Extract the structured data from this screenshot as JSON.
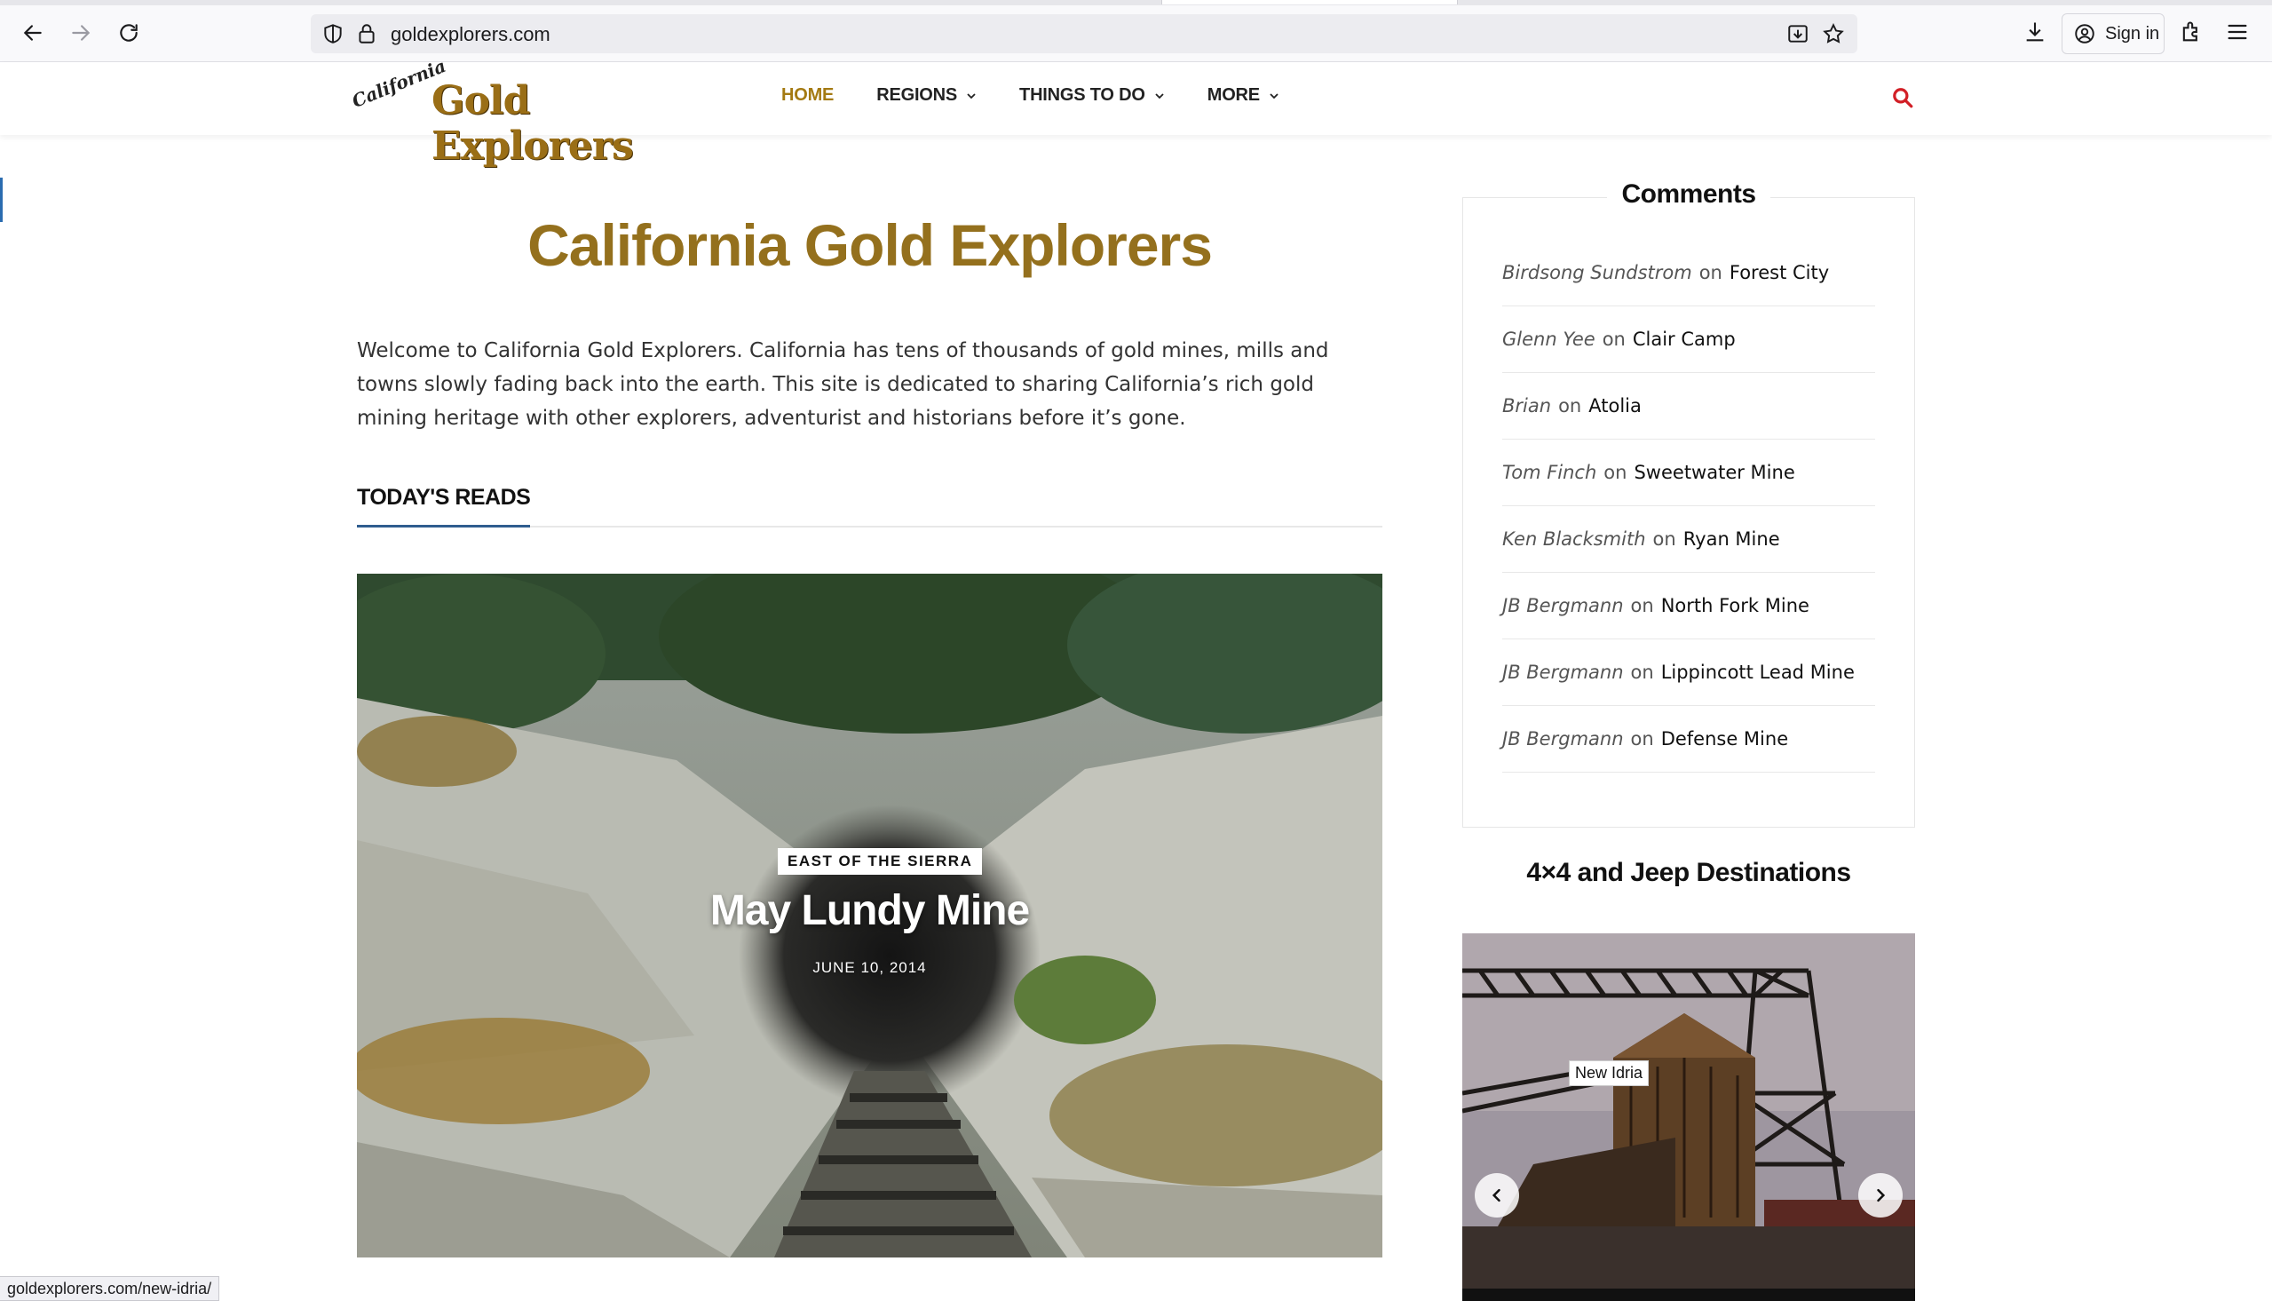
{
  "browser": {
    "url": "goldexplorers.com",
    "sign_in_label": "Sign in",
    "status_url": "goldexplorers.com/new-idria/"
  },
  "site": {
    "logo_small": "California",
    "logo_big": "Gold Explorers",
    "nav": [
      {
        "label": "HOME",
        "active": true,
        "dropdown": false
      },
      {
        "label": "REGIONS",
        "active": false,
        "dropdown": true
      },
      {
        "label": "THINGS TO DO",
        "active": false,
        "dropdown": true
      },
      {
        "label": "MORE",
        "active": false,
        "dropdown": true
      }
    ],
    "accent_color": "#a47a12",
    "search_icon_color": "#d21f26"
  },
  "main": {
    "title": "California Gold Explorers",
    "intro": "Welcome to California Gold Explorers. California has tens of thousands of gold mines, mills and towns slowly fading back into the earth. This site is dedicated to sharing California’s rich gold mining heritage with other explorers, adventurist and historians before it’s gone.",
    "section_title": "TODAY'S READS",
    "featured": {
      "category": "EAST OF THE SIERRA",
      "title": "May Lundy Mine",
      "date": "JUNE 10, 2014"
    }
  },
  "sidebar": {
    "comments_title": "Comments",
    "comments": [
      {
        "author": "Birdsong Sundstrom",
        "on": "on",
        "post": "Forest City"
      },
      {
        "author": "Glenn Yee",
        "on": "on",
        "post": "Clair Camp"
      },
      {
        "author": "Brian",
        "on": "on",
        "post": "Atolia"
      },
      {
        "author": "Tom Finch",
        "on": "on",
        "post": "Sweetwater Mine"
      },
      {
        "author": "Ken Blacksmith",
        "on": "on",
        "post": "Ryan Mine"
      },
      {
        "author": "JB Bergmann",
        "on": "on",
        "post": "North Fork Mine"
      },
      {
        "author": "JB Bergmann",
        "on": "on",
        "post": "Lippincott Lead Mine"
      },
      {
        "author": "JB Bergmann",
        "on": "on",
        "post": "Defense Mine"
      }
    ],
    "widget_title": "4×4 and Jeep Destinations",
    "slide_label": "New Idria"
  }
}
